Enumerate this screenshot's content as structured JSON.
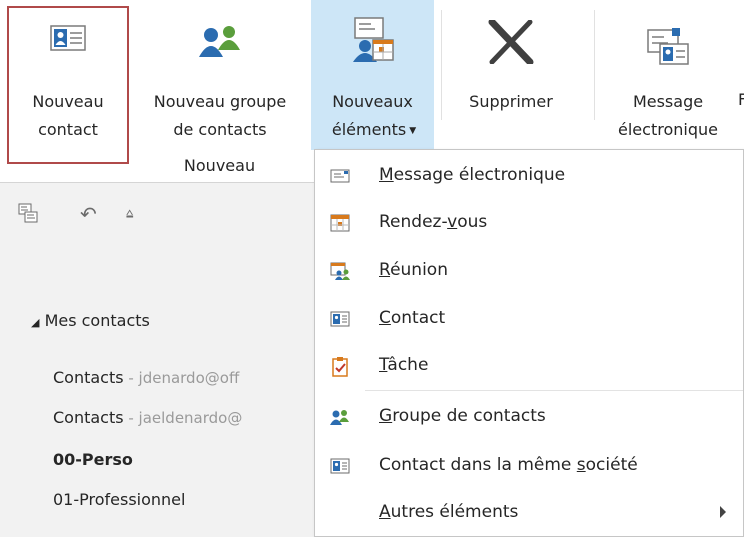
{
  "ribbon": {
    "new_contact": {
      "line1": "Nouveau",
      "line2": "contact"
    },
    "new_group": {
      "line1": "Nouveau groupe",
      "line2": "de contacts"
    },
    "new_items": {
      "line1": "Nouveaux",
      "line2": "éléments"
    },
    "delete": {
      "line1": "Supprimer"
    },
    "email": {
      "line1": "Message",
      "line2": "électronique"
    },
    "group_label": "Nouveau",
    "truncated_next": "F"
  },
  "left_pane": {
    "section_header": "Mes contacts",
    "folders": [
      {
        "name": "Contacts",
        "account": " - jdenardo@off"
      },
      {
        "name": "Contacts",
        "account": " - jaeldenardo@"
      },
      {
        "name": "00-Perso",
        "account": ""
      },
      {
        "name": "01-Professionnel",
        "account": ""
      }
    ]
  },
  "dropdown": {
    "items": [
      {
        "icon": "email-icon",
        "before": "",
        "accel": "M",
        "after": "essage électronique"
      },
      {
        "icon": "calendar-icon",
        "before": "Rendez-",
        "accel": "v",
        "after": "ous"
      },
      {
        "icon": "meeting-icon",
        "before": "",
        "accel": "R",
        "after": "éunion"
      },
      {
        "icon": "contact-card-icon",
        "before": "",
        "accel": "C",
        "after": "ontact"
      },
      {
        "icon": "task-icon",
        "before": "",
        "accel": "T",
        "after": "âche"
      },
      {
        "icon": "contact-group-icon",
        "before": "",
        "accel": "G",
        "after": "roupe de contacts"
      },
      {
        "icon": "contact-card-icon",
        "before": "Contact dans la même ",
        "accel": "s",
        "after": "ociété"
      },
      {
        "icon": "",
        "before": "",
        "accel": "A",
        "after": "utres éléments"
      }
    ]
  },
  "colors": {
    "highlight": "#cde6f7",
    "focus_border": "#b04a4a",
    "pane_bg": "#f2f2f2"
  }
}
